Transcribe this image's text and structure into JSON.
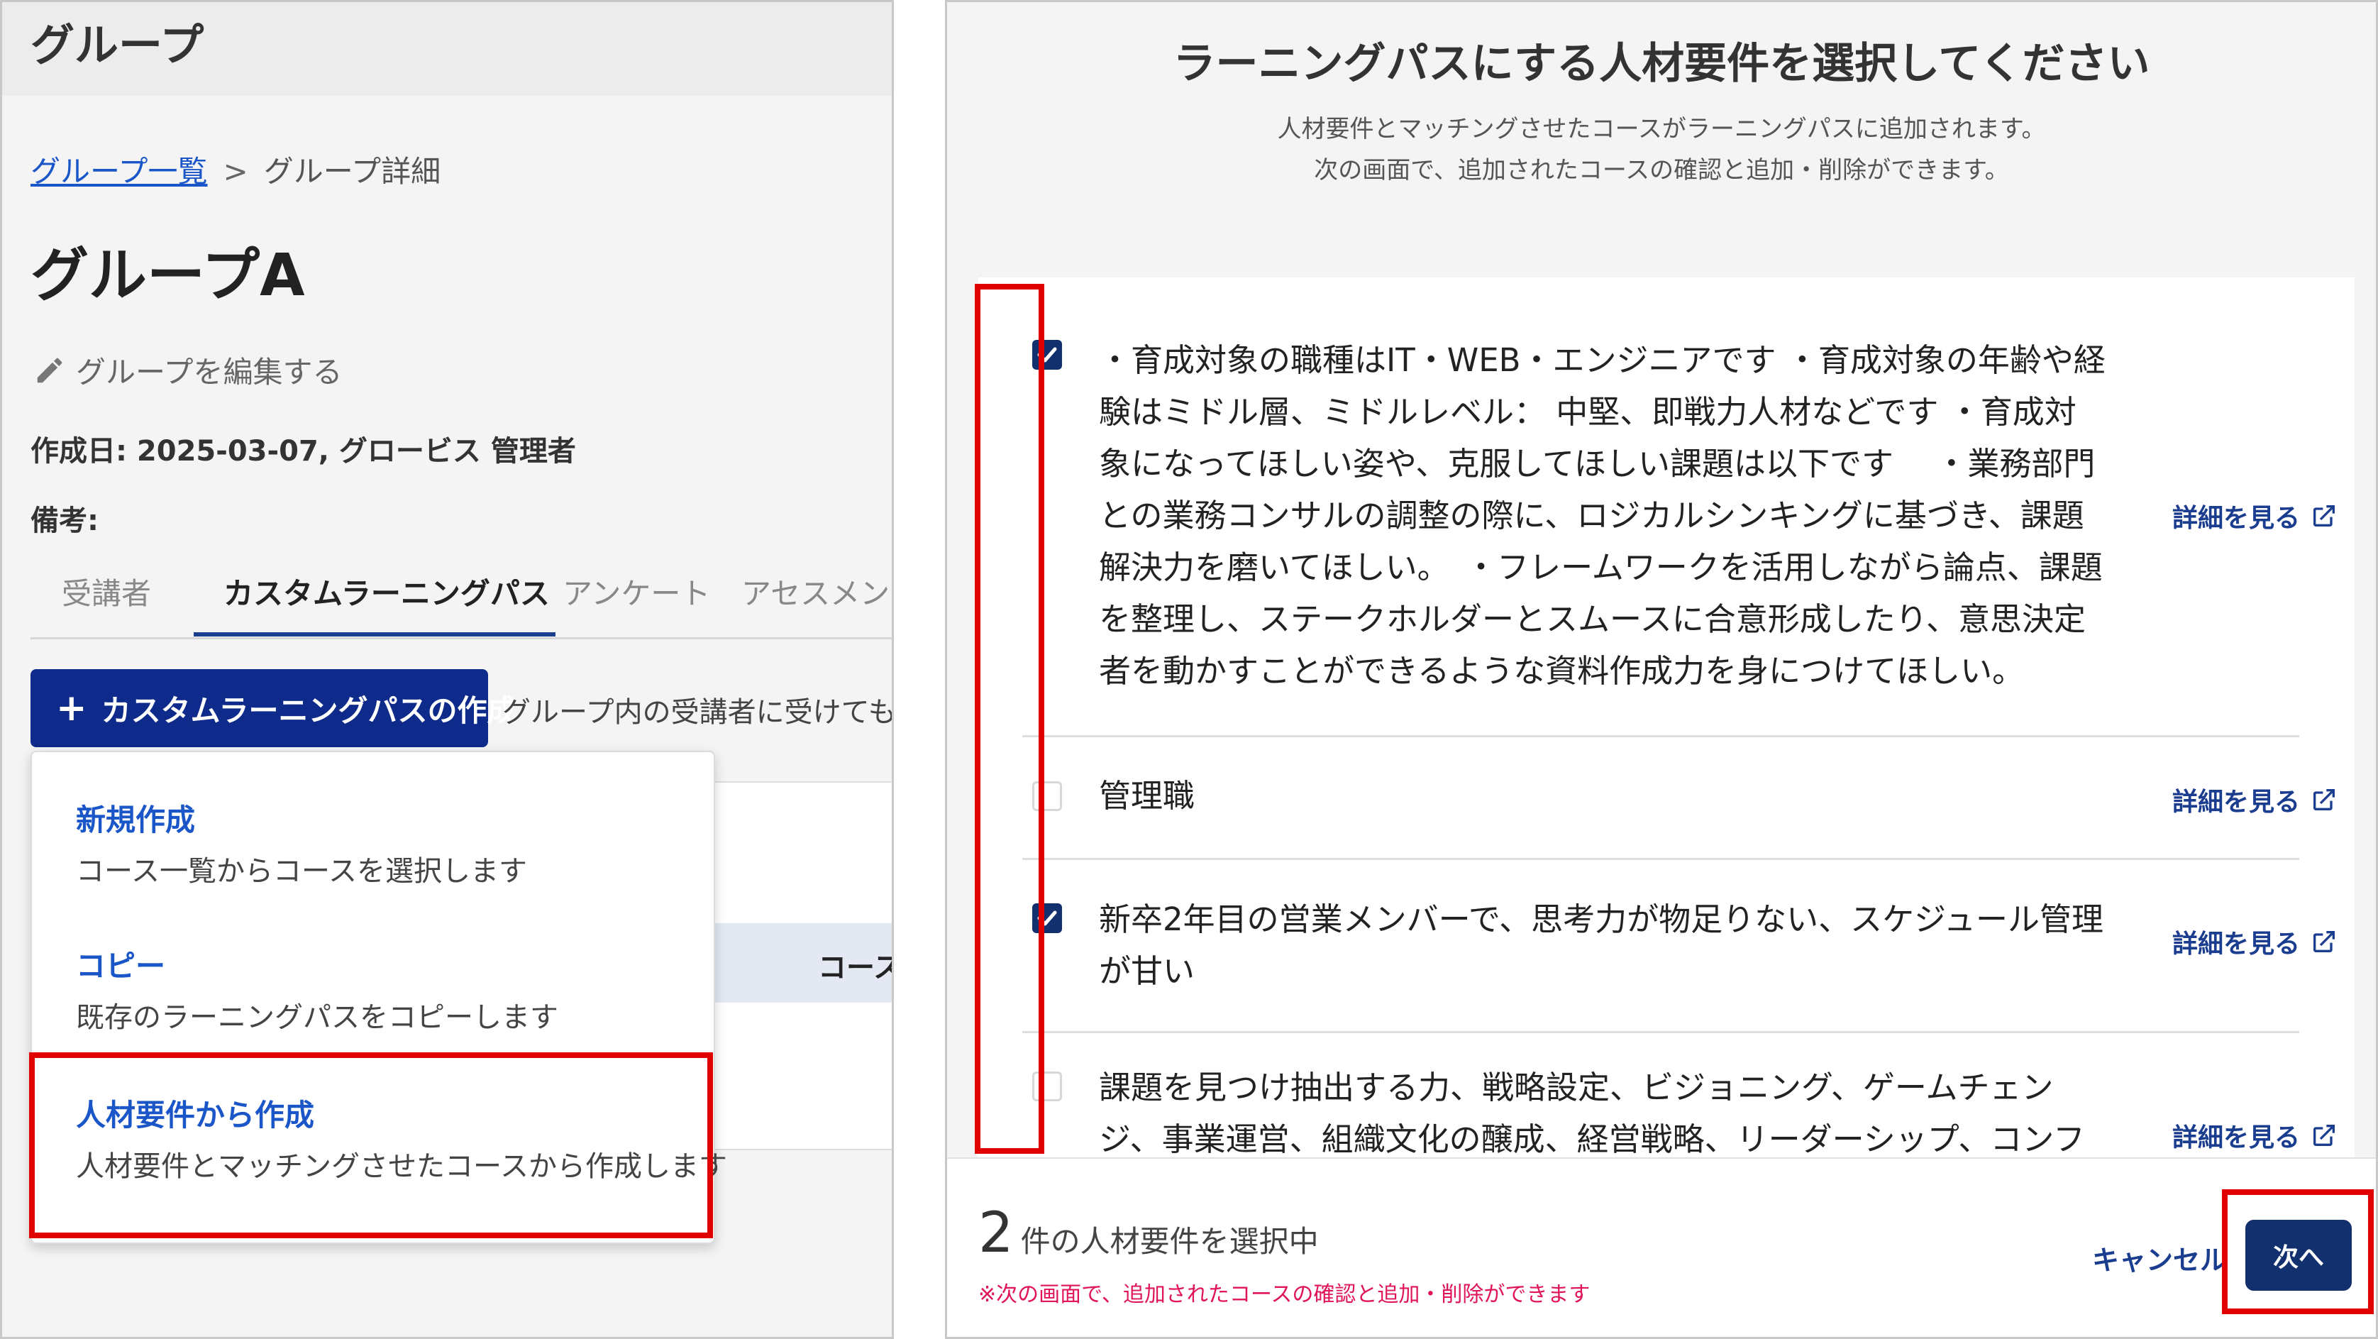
{
  "left": {
    "header_title": "グループ",
    "breadcrumb": {
      "link": "グループ一覧",
      "separator": ">",
      "current": "グループ詳細"
    },
    "group_title": "グループA",
    "edit_label": "グループを編集する",
    "created_line": "作成日: 2025-03-07, グロービス 管理者",
    "remarks_label": "備考:",
    "tabs": [
      {
        "label": "受講者"
      },
      {
        "label": "カスタムラーニングパス"
      },
      {
        "label": "アンケート"
      },
      {
        "label": "アセスメント"
      }
    ],
    "create_button": {
      "plus": "+",
      "label": "カスタムラーニングパスの作成"
    },
    "helper_text": "グループ内の受講者に受けても",
    "background_row_text": "コース",
    "dropdown": [
      {
        "title": "新規作成",
        "desc": "コース一覧からコースを選択します"
      },
      {
        "title": "コピー",
        "desc": "既存のラーニングパスをコピーします"
      },
      {
        "title": "人材要件から作成",
        "desc": "人材要件とマッチングさせたコースから作成します"
      }
    ]
  },
  "right": {
    "title": "ラーニングパスにする人材要件を選択してください",
    "subtitle_line1": "人材要件とマッチングさせたコースがラーニングパスに追加されます。",
    "subtitle_line2": "次の画面で、追加されたコースの確認と追加・削除ができます。",
    "detail_label": "詳細を見る",
    "items": [
      {
        "checked": true,
        "text": "・育成対象の職種はIT・WEB・エンジニアです ・育成対象の年齢や経験はミドル層、ミドルレベル： 中堅、即戦力人材などです ・育成対象になってほしい姿や、克服してほしい課題は以下です　 ・業務部門との業務コンサルの調整の際に、ロジカルシンキングに基づき、課題解決力を磨いてほしい。　・フレームワークを活用しながら論点、課題を整理し、ステークホルダーとスムースに合意形成したり、意思決定者を動かすことができるような資料作成力を身につけてほしい。"
      },
      {
        "checked": false,
        "text": "管理職"
      },
      {
        "checked": true,
        "text": "新卒2年目の営業メンバーで、思考力が物足りない、スケジュール管理が甘い"
      },
      {
        "checked": false,
        "text": "課題を見つけ抽出する力、戦略設定、ビジョニング、ゲームチェンジ、事業運営、組織文化の醸成、経営戦略、リーダーシップ、コンフリクトマネ"
      }
    ],
    "footer": {
      "count": "2",
      "count_label": "件の人材要件を選択中",
      "note": "※次の画面で、追加されたコースの確認と追加・削除ができます",
      "cancel_label": "キャンセル",
      "next_label": "次へ"
    }
  },
  "colors": {
    "accent": "#0e2a8a",
    "link": "#1a56c8",
    "highlight": "#e00000",
    "note": "#e0145a"
  },
  "icons": [
    "pencil-icon",
    "plus-icon",
    "checkmark-icon",
    "external-link-icon"
  ]
}
